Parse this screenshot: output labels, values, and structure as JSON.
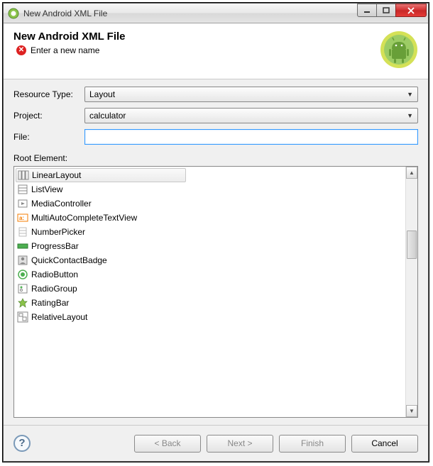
{
  "titlebar": {
    "title": "New Android XML File"
  },
  "header": {
    "title": "New Android XML File",
    "error_msg": "Enter a new name"
  },
  "form": {
    "resource_type_label": "Resource Type:",
    "resource_type_value": "Layout",
    "project_label": "Project:",
    "project_value": "calculator",
    "file_label": "File:",
    "file_value": "",
    "root_element_label": "Root Element:"
  },
  "root_elements": [
    "LinearLayout",
    "ListView",
    "MediaController",
    "MultiAutoCompleteTextView",
    "NumberPicker",
    "ProgressBar",
    "QuickContactBadge",
    "RadioButton",
    "RadioGroup",
    "RatingBar",
    "RelativeLayout"
  ],
  "buttons": {
    "back": "< Back",
    "next": "Next >",
    "finish": "Finish",
    "cancel": "Cancel"
  }
}
